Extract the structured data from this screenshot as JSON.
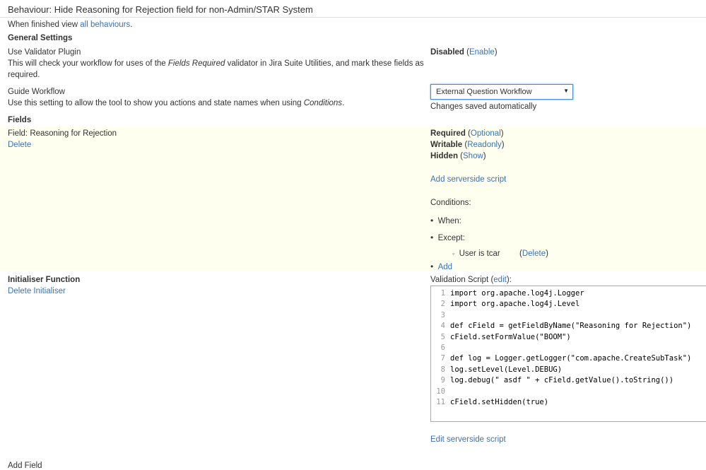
{
  "header": {
    "title": "Behaviour: Hide Reasoning for Rejection field for non-Admin/STAR System",
    "finished_prefix": "When finished view ",
    "finished_link": "all behaviours",
    "finished_suffix": "."
  },
  "general": {
    "heading": "General Settings",
    "validator": {
      "label": "Use Validator Plugin",
      "desc_line1_a": "This will check your workflow for uses of the ",
      "desc_line1_em": "Fields Required",
      "desc_line1_b": " validator in Jira Suite Utilities, and mark these fields as",
      "desc_line2": "required.",
      "status": "Disabled",
      "action_open": " (",
      "action": "Enable",
      "action_close": ")"
    },
    "guide": {
      "label": "Guide Workflow",
      "desc_a": "Use this setting to allow the tool to show you actions and state names when using ",
      "desc_em": "Conditions",
      "desc_b": ".",
      "selected": "External Question Workflow",
      "saved": "Changes saved automatically"
    }
  },
  "fields": {
    "heading": "Fields",
    "field_label": "Field: Reasoning for Rejection",
    "delete": "Delete",
    "required": "Required",
    "required_toggle": "Optional",
    "writable": "Writable",
    "writable_toggle": "Readonly",
    "hidden": "Hidden",
    "hidden_toggle": "Show",
    "open": " (",
    "close": ")",
    "add_script": "Add serverside script",
    "conditions": "Conditions:",
    "when": "When:",
    "except": "Except:",
    "except_item": "User is tcar",
    "except_delete": "Delete",
    "add": "Add"
  },
  "initialiser": {
    "heading": "Initialiser Function",
    "delete": "Delete Initialiser",
    "validation_label_a": "Validation Script (",
    "validation_edit": "edit",
    "validation_label_b": "):",
    "code_lines": [
      {
        "n": "1",
        "t": "import org.apache.log4j.Logger"
      },
      {
        "n": "2",
        "t": "import org.apache.log4j.Level"
      },
      {
        "n": "3",
        "t": ""
      },
      {
        "n": "4",
        "t": "def cField = getFieldByName(\"Reasoning for Rejection\")"
      },
      {
        "n": "5",
        "t": "cField.setFormValue(\"BOOM\")"
      },
      {
        "n": "6",
        "t": ""
      },
      {
        "n": "7",
        "t": "def log = Logger.getLogger(\"com.apache.CreateSubTask\")"
      },
      {
        "n": "8",
        "t": "log.setLevel(Level.DEBUG)"
      },
      {
        "n": "9",
        "t": "log.debug(\" asdf \" + cField.getValue().toString())"
      },
      {
        "n": "10",
        "t": ""
      },
      {
        "n": "11",
        "t": "cField.setHidden(true)"
      }
    ],
    "edit_script": "Edit serverside script"
  },
  "footer": {
    "add_field": "Add Field"
  }
}
